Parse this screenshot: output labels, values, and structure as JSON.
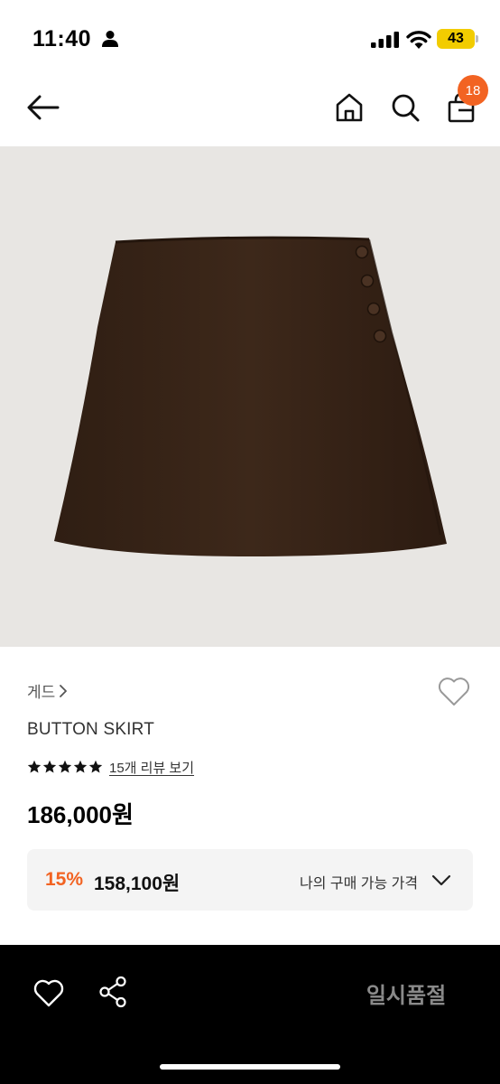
{
  "status_bar": {
    "time": "11:40",
    "battery": "43",
    "icons": [
      "person-icon",
      "signal-icon",
      "wifi-icon",
      "battery-icon"
    ]
  },
  "header": {
    "icons": [
      "back-arrow-icon",
      "home-icon",
      "search-icon",
      "shopping-bag-icon"
    ],
    "cart_count": "18"
  },
  "product": {
    "brand": "게드",
    "name": "BUTTON SKIRT",
    "rating_stars": 5,
    "review_link": "15개 리뷰 보기",
    "price": "186,000원",
    "discount_rate": "15%",
    "discount_price": "158,100원",
    "discount_label": "나의 구매 가능 가격"
  },
  "bottom_bar": {
    "icons": [
      "heart-icon",
      "share-icon"
    ],
    "soldout_label": "일시품절"
  },
  "colors": {
    "accent": "#f26322",
    "image_bg": "#e8e6e3",
    "skirt": "#3b2618",
    "battery": "#f2cc00"
  }
}
